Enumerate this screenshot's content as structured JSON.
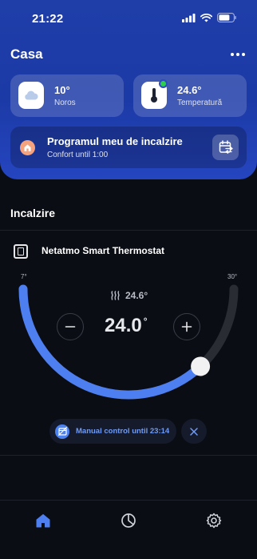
{
  "status": {
    "time": "21:22"
  },
  "header": {
    "title": "Casa"
  },
  "weather_tile": {
    "value": "10°",
    "label": "Noros",
    "icon": "cloud-icon"
  },
  "temperature_tile": {
    "value": "24.6°",
    "label": "Temperatură",
    "icon": "thermometer-icon",
    "online_color": "#2ecc52"
  },
  "schedule": {
    "title": "Programul meu de incalzire",
    "subtitle": "Confort until 1:00",
    "icon": "home-icon",
    "action_icon": "calendar-swap-icon"
  },
  "section": {
    "title": "Incalzire"
  },
  "device": {
    "name": "Netatmo Smart Thermostat",
    "icon": "thermostat-icon"
  },
  "thermostat": {
    "min_label": "7°",
    "max_label": "30°",
    "min": 7,
    "max": 30,
    "setpoint": 24.0,
    "current_temp": "24.6°",
    "target_value": "24.0",
    "target_unit": "°",
    "accent_color": "#4d7ff0",
    "track_color": "#2a2c33"
  },
  "manual": {
    "text": "Manual control until 23:14",
    "icon": "calendar-off-icon",
    "close_icon": "close-icon"
  },
  "tabs": [
    {
      "name": "home",
      "icon": "home-icon",
      "active": true
    },
    {
      "name": "stats",
      "icon": "pie-chart-icon",
      "active": false
    },
    {
      "name": "settings",
      "icon": "gear-icon",
      "active": false
    }
  ]
}
